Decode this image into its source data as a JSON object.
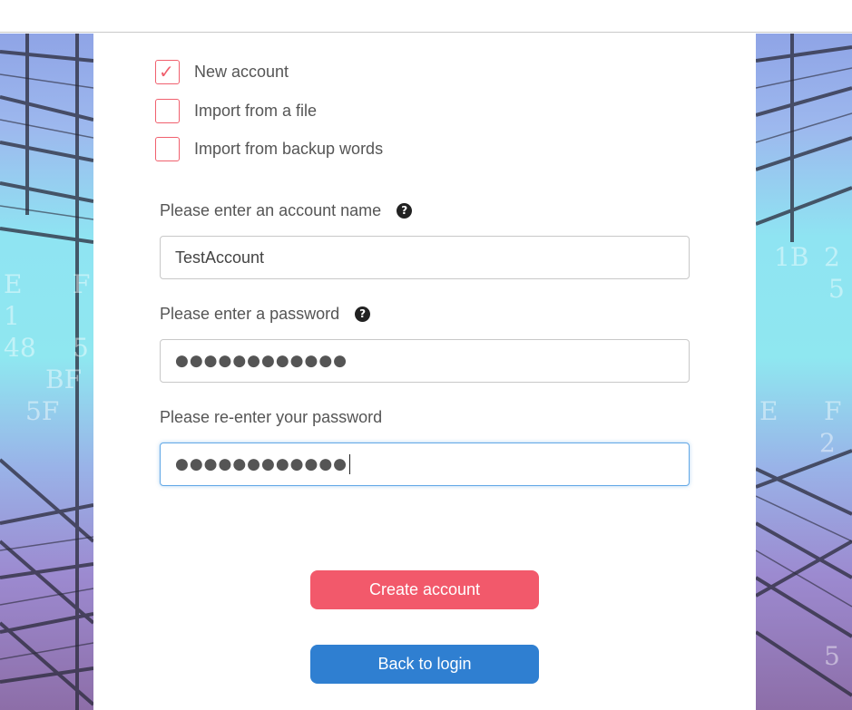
{
  "options": [
    {
      "label": "New account",
      "checked": true
    },
    {
      "label": "Import from a file",
      "checked": false
    },
    {
      "label": "Import from backup words",
      "checked": false
    }
  ],
  "account_name": {
    "label": "Please enter an account name",
    "value": "TestAccount"
  },
  "password": {
    "label": "Please enter a password",
    "value": "●●●●●●●●●●●●"
  },
  "password_confirm": {
    "label": "Please re-enter your password",
    "value": "●●●●●●●●●●●●"
  },
  "buttons": {
    "create": "Create account",
    "back": "Back to login"
  },
  "icons": {
    "help": "?",
    "check": "✓"
  },
  "colors": {
    "accent": "#f2596b",
    "secondary": "#2f7fd1",
    "focus": "#62a8e6"
  }
}
